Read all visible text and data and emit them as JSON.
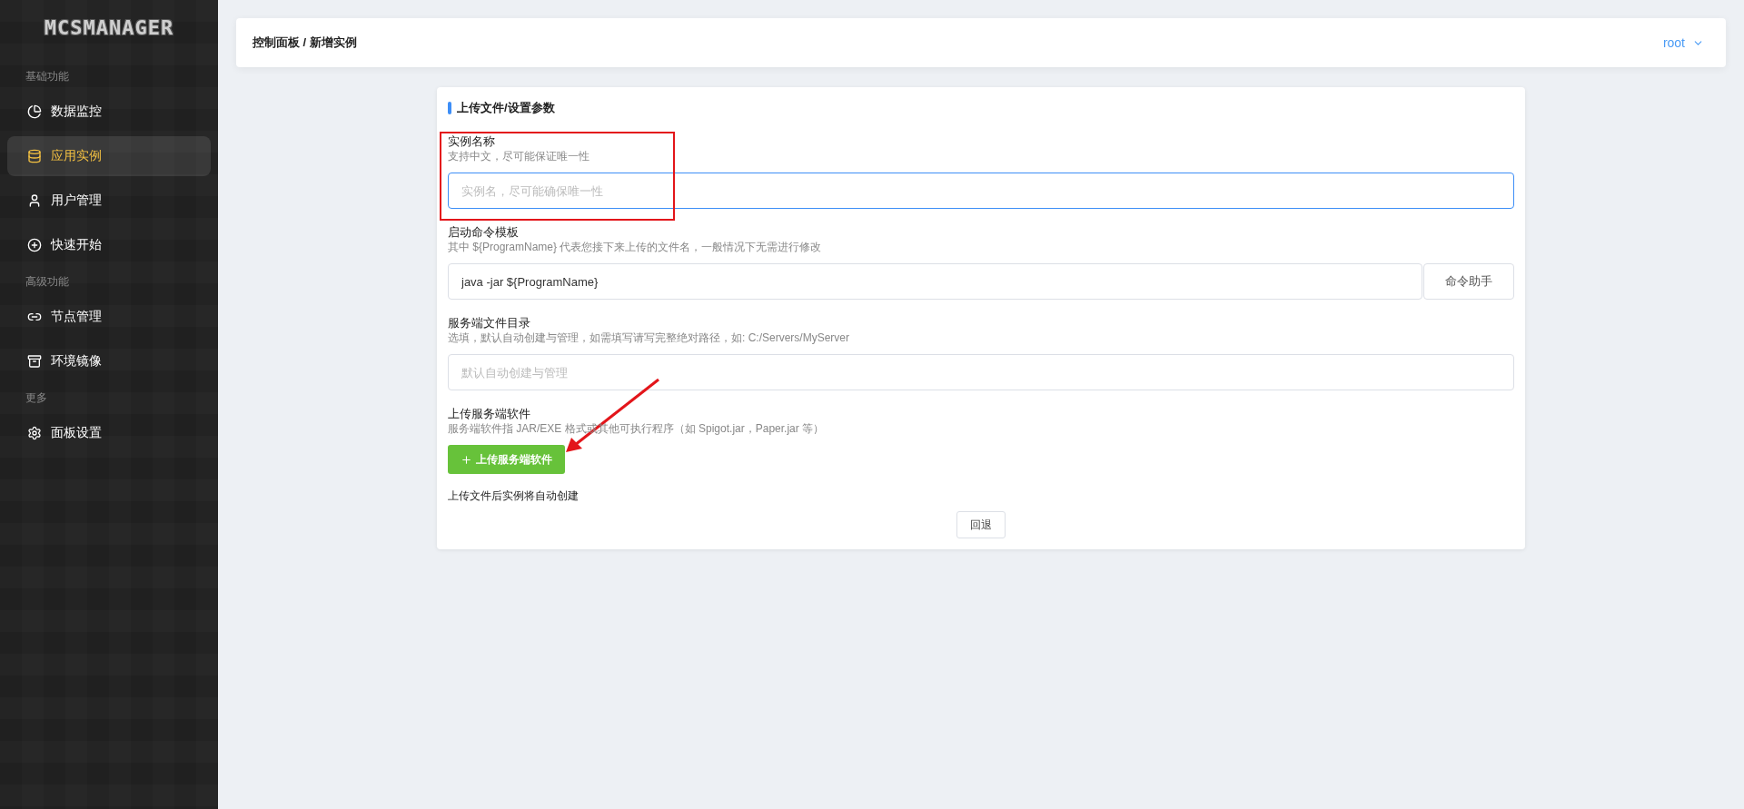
{
  "sidebar": {
    "logo": "MCSMANAGER",
    "groups": [
      {
        "title": "基础功能",
        "items": [
          {
            "label": "数据监控",
            "selected": false
          },
          {
            "label": "应用实例",
            "selected": true
          },
          {
            "label": "用户管理",
            "selected": false
          },
          {
            "label": "快速开始",
            "selected": false
          }
        ]
      },
      {
        "title": "高级功能",
        "items": [
          {
            "label": "节点管理",
            "selected": false
          },
          {
            "label": "环境镜像",
            "selected": false
          }
        ]
      },
      {
        "title": "更多",
        "items": [
          {
            "label": "面板设置",
            "selected": false
          }
        ]
      }
    ]
  },
  "header": {
    "breadcrumb": "控制面板 / 新增实例",
    "user": "root"
  },
  "form": {
    "title": "上传文件/设置参数",
    "fields": [
      {
        "label": "实例名称",
        "hint": "支持中文，尽可能保证唯一性",
        "placeholder": "实例名，尽可能确保唯一性",
        "focused": true
      },
      {
        "label": "启动命令模板",
        "hint": "其中 ${ProgramName} 代表您接下来上传的文件名，一般情况下无需进行修改",
        "value": "java -jar ${ProgramName}",
        "button": "命令助手",
        "focused": false
      },
      {
        "label": "服务端文件目录",
        "hint": "选填，默认自动创建与管理，如需填写请写完整绝对路径，如: C:/Servers/MyServer",
        "placeholder": "默认自动创建与管理",
        "focused": false
      }
    ],
    "upload": {
      "label": "上传服务端软件",
      "hint": "服务端软件指 JAR/EXE 格式或其他可执行程序（如 Spigot.jar，Paper.jar 等）",
      "button": "上传服务端软件"
    },
    "note": "上传文件后实例将自动创建",
    "back_button": "回退"
  }
}
